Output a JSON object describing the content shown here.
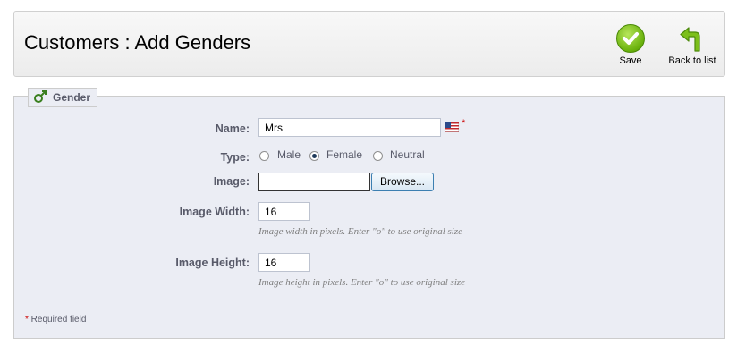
{
  "header": {
    "title": "Customers : Add Genders",
    "save_label": "Save",
    "back_label": "Back to list"
  },
  "form": {
    "legend": "Gender",
    "name": {
      "label": "Name:",
      "value": "Mrs",
      "required_mark": "*"
    },
    "type": {
      "label": "Type:",
      "options": [
        "Male",
        "Female",
        "Neutral"
      ],
      "selected": "Female"
    },
    "image": {
      "label": "Image:",
      "browse_label": "Browse..."
    },
    "image_width": {
      "label": "Image Width:",
      "value": "16",
      "hint": "Image width in pixels. Enter \"o\" to use original size"
    },
    "image_height": {
      "label": "Image Height:",
      "value": "16",
      "hint": "Image height in pixels. Enter \"o\" to use original size"
    },
    "required_note": {
      "mark": "*",
      "text": " Required field"
    }
  },
  "colors": {
    "panel_bg": "#ebedf4",
    "label_text": "#585a69",
    "required": "#cc0000",
    "save_green": "#69b10c"
  },
  "icons": {
    "save": "save-check-icon",
    "back": "back-arrow-icon",
    "legend": "gender-icon",
    "flag": "us-flag-icon"
  }
}
